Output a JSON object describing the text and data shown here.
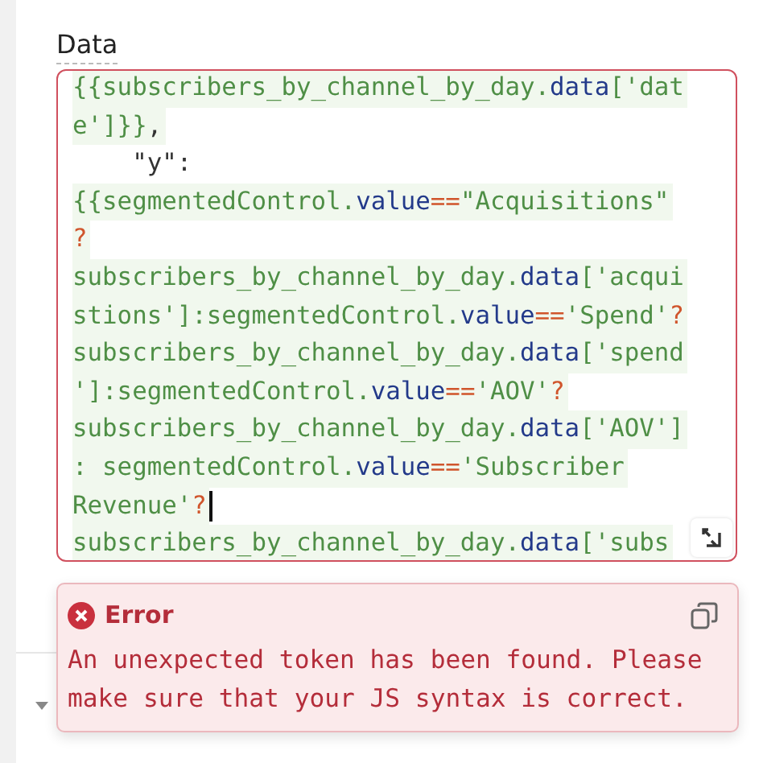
{
  "section": {
    "title": "Data"
  },
  "editor": {
    "lines": [
      {
        "embedded": true,
        "segments": [
          {
            "kind": "str",
            "text": "{{subscribers_by_channel_by_day."
          },
          {
            "kind": "prop",
            "text": "data"
          },
          {
            "kind": "str",
            "text": "['dat"
          }
        ]
      },
      {
        "embedded": true,
        "segments": [
          {
            "kind": "str",
            "text": "e']}}"
          },
          {
            "kind": "plain",
            "text": ","
          }
        ]
      },
      {
        "embedded": false,
        "segments": [
          {
            "kind": "plain",
            "text": "    \"y\":"
          }
        ]
      },
      {
        "embedded": true,
        "segments": [
          {
            "kind": "str",
            "text": "{{segmentedControl."
          },
          {
            "kind": "prop",
            "text": "value"
          },
          {
            "kind": "op",
            "text": "=="
          },
          {
            "kind": "str",
            "text": "\"Acquisitions\""
          }
        ]
      },
      {
        "embedded": true,
        "segments": [
          {
            "kind": "op",
            "text": "?"
          }
        ]
      },
      {
        "embedded": true,
        "segments": [
          {
            "kind": "str",
            "text": "subscribers_by_channel_by_day."
          },
          {
            "kind": "prop",
            "text": "data"
          },
          {
            "kind": "str",
            "text": "['acqui"
          }
        ]
      },
      {
        "embedded": true,
        "segments": [
          {
            "kind": "str",
            "text": "stions']:segmentedControl."
          },
          {
            "kind": "prop",
            "text": "value"
          },
          {
            "kind": "op",
            "text": "=="
          },
          {
            "kind": "str",
            "text": "'Spend'"
          },
          {
            "kind": "op",
            "text": "?"
          }
        ]
      },
      {
        "embedded": true,
        "segments": [
          {
            "kind": "str",
            "text": "subscribers_by_channel_by_day."
          },
          {
            "kind": "prop",
            "text": "data"
          },
          {
            "kind": "str",
            "text": "['spend"
          }
        ]
      },
      {
        "embedded": true,
        "segments": [
          {
            "kind": "str",
            "text": "']:segmentedControl."
          },
          {
            "kind": "prop",
            "text": "value"
          },
          {
            "kind": "op",
            "text": "=="
          },
          {
            "kind": "str",
            "text": "'AOV'"
          },
          {
            "kind": "op",
            "text": "?"
          }
        ]
      },
      {
        "embedded": true,
        "segments": [
          {
            "kind": "str",
            "text": "subscribers_by_channel_by_day."
          },
          {
            "kind": "prop",
            "text": "data"
          },
          {
            "kind": "str",
            "text": "['AOV']"
          }
        ]
      },
      {
        "embedded": true,
        "segments": [
          {
            "kind": "str",
            "text": ": segmentedControl."
          },
          {
            "kind": "prop",
            "text": "value"
          },
          {
            "kind": "op",
            "text": "=="
          },
          {
            "kind": "str",
            "text": "'Subscriber"
          }
        ]
      },
      {
        "embedded": true,
        "cursor": true,
        "segments": [
          {
            "kind": "str",
            "text": "Revenue'"
          },
          {
            "kind": "op",
            "text": "?"
          }
        ]
      },
      {
        "embedded": true,
        "segments": [
          {
            "kind": "str",
            "text": "subscribers_by_channel_by_day."
          },
          {
            "kind": "prop",
            "text": "data"
          },
          {
            "kind": "str",
            "text": "['subs"
          }
        ]
      }
    ],
    "has_error": true
  },
  "error": {
    "title": "Error",
    "message": "An unexpected token has been found. Please make sure that your JS syntax is correct."
  }
}
